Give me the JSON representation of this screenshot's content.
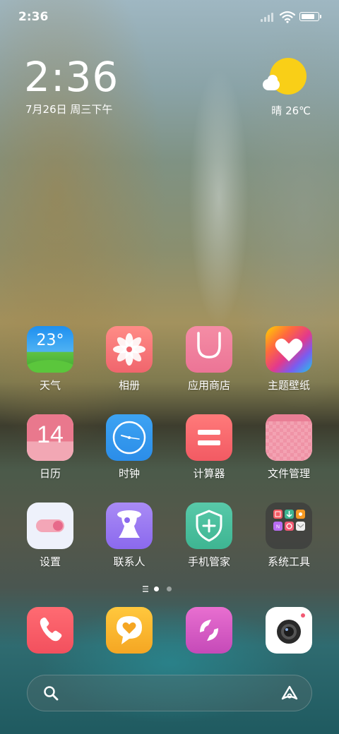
{
  "status_bar": {
    "time": "2:36",
    "battery_level": 0.9
  },
  "clock_widget": {
    "time": "2:36",
    "date": "7月26日 周三下午"
  },
  "weather_widget": {
    "text": "晴 26℃",
    "icon": "sun-cloud-icon"
  },
  "apps": [
    {
      "label": "天气",
      "icon": "weather-icon",
      "icon_text": "23°"
    },
    {
      "label": "相册",
      "icon": "flower-icon"
    },
    {
      "label": "应用商店",
      "icon": "shopping-bag-icon"
    },
    {
      "label": "主题壁纸",
      "icon": "heart-icon"
    },
    {
      "label": "日历",
      "icon": "calendar-icon",
      "icon_text": "14"
    },
    {
      "label": "时钟",
      "icon": "clock-icon"
    },
    {
      "label": "计算器",
      "icon": "equals-icon"
    },
    {
      "label": "文件管理",
      "icon": "folder-icon"
    },
    {
      "label": "设置",
      "icon": "toggle-icon"
    },
    {
      "label": "联系人",
      "icon": "person-icon"
    },
    {
      "label": "手机管家",
      "icon": "shield-plus-icon"
    },
    {
      "label": "系统工具",
      "icon": "app-folder-icon"
    }
  ],
  "pager": {
    "pages": 2,
    "current": 1
  },
  "dock": [
    {
      "icon": "phone-icon"
    },
    {
      "icon": "message-heart-icon"
    },
    {
      "icon": "browser-icon"
    },
    {
      "icon": "camera-icon"
    }
  ],
  "search_bar": {
    "left_icon": "search-icon",
    "right_icon": "assistant-icon"
  },
  "colors": {
    "weather_sun": "#f9cf17",
    "gallery": "#f0656d",
    "store": "#ec7496",
    "calendar": "#e9788d",
    "clock": "#2b8de8",
    "calculator": "#f25a63",
    "files": "#f3a2b2",
    "contacts": "#8b69ee",
    "security": "#3eb592",
    "phone": "#f2505e",
    "messages": "#f5a623",
    "browser": "#c54ab8"
  }
}
